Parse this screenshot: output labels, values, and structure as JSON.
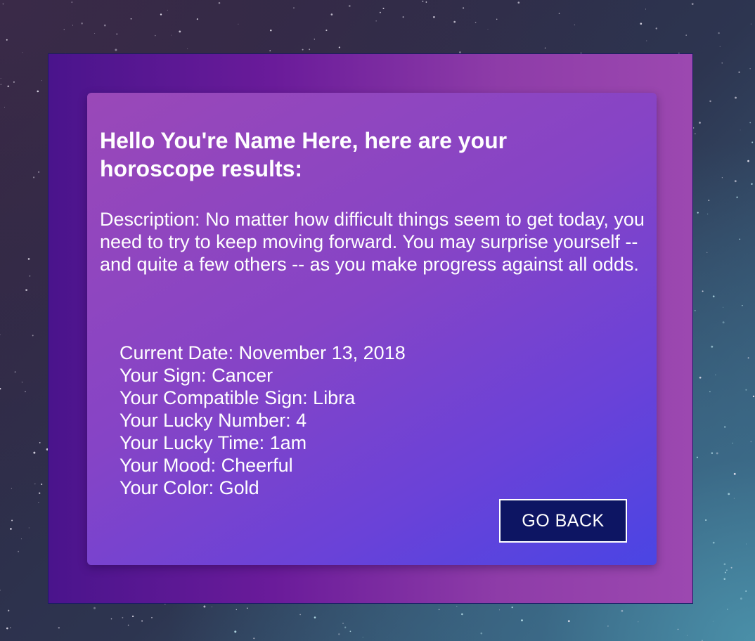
{
  "result": {
    "greeting": "Hello You're Name Here, here are your horoscope results:",
    "description_label": "Description: ",
    "description": "No matter how difficult things seem to get today, you need to try to keep moving forward. You may surprise yourself -- and quite a few others -- as you make progress against all odds.",
    "details": [
      {
        "label": "Current Date: ",
        "value": "November 13, 2018"
      },
      {
        "label": "Your Sign: ",
        "value": "Cancer"
      },
      {
        "label": "Your Compatible Sign: ",
        "value": "Libra"
      },
      {
        "label": "Your Lucky Number: ",
        "value": "4"
      },
      {
        "label": "Your Lucky Time: ",
        "value": "1am"
      },
      {
        "label": "Your Mood: ",
        "value": "Cheerful"
      },
      {
        "label": "Your Color: ",
        "value": "Gold"
      }
    ],
    "go_back_label": "GO BACK"
  },
  "colors": {
    "button_bg": "#0d1563",
    "text": "#ffffff",
    "frame_start": "#4a148c",
    "frame_end": "#9c48b0"
  }
}
